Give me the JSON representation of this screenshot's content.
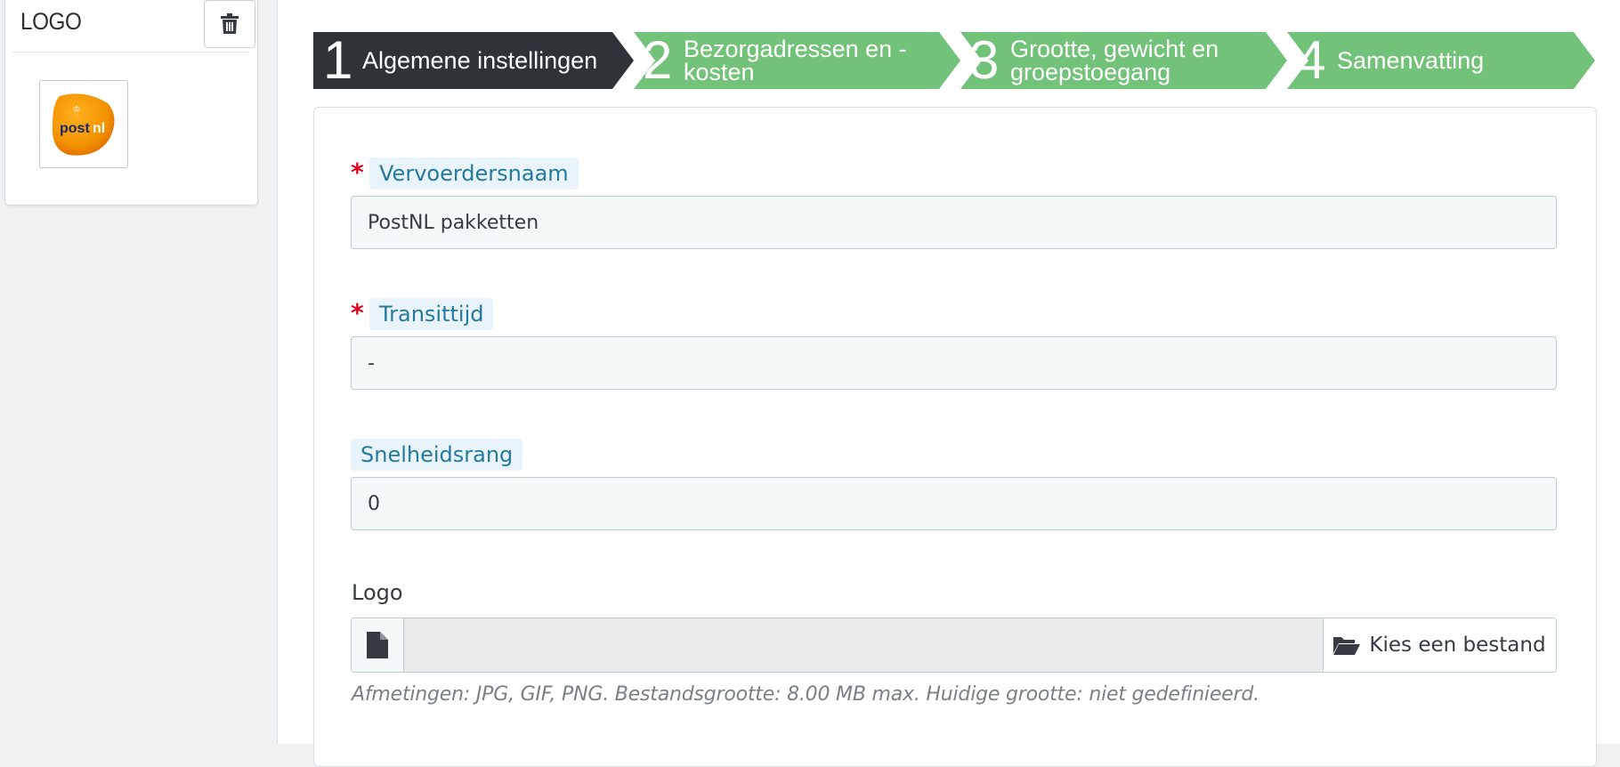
{
  "logo_panel": {
    "title": "LOGO",
    "delete_icon": "trash-icon",
    "image_alt": "PostNL logo",
    "image_text": "postnl"
  },
  "wizard": {
    "active_color": "#2e3338",
    "inactive_color": "#72c279",
    "steps": [
      {
        "number": "1",
        "label_line1": "Algemene instellingen",
        "label_line2": "",
        "active": true
      },
      {
        "number": "2",
        "label_line1": "Bezorgadressen en -",
        "label_line2": "kosten",
        "active": false
      },
      {
        "number": "3",
        "label_line1": "Grootte, gewicht en",
        "label_line2": "groepstoegang",
        "active": false
      },
      {
        "number": "4",
        "label_line1": "Samenvatting",
        "label_line2": "",
        "active": false
      }
    ]
  },
  "form": {
    "carrier_name": {
      "label": "Vervoerdersnaam",
      "required": true,
      "value": "PostNL pakketten"
    },
    "transit_time": {
      "label": "Transittijd",
      "required": true,
      "value": "-"
    },
    "speed_grade": {
      "label": "Snelheidsrang",
      "required": false,
      "value": "0"
    },
    "logo": {
      "label": "Logo",
      "file_icon": "file-icon",
      "button_icon": "folder-open-icon",
      "button_label": "Kies een bestand",
      "help": "Afmetingen: JPG, GIF, PNG. Bestandsgrootte: 8.00 MB max. Huidige grootte: niet gedefinieerd."
    }
  }
}
